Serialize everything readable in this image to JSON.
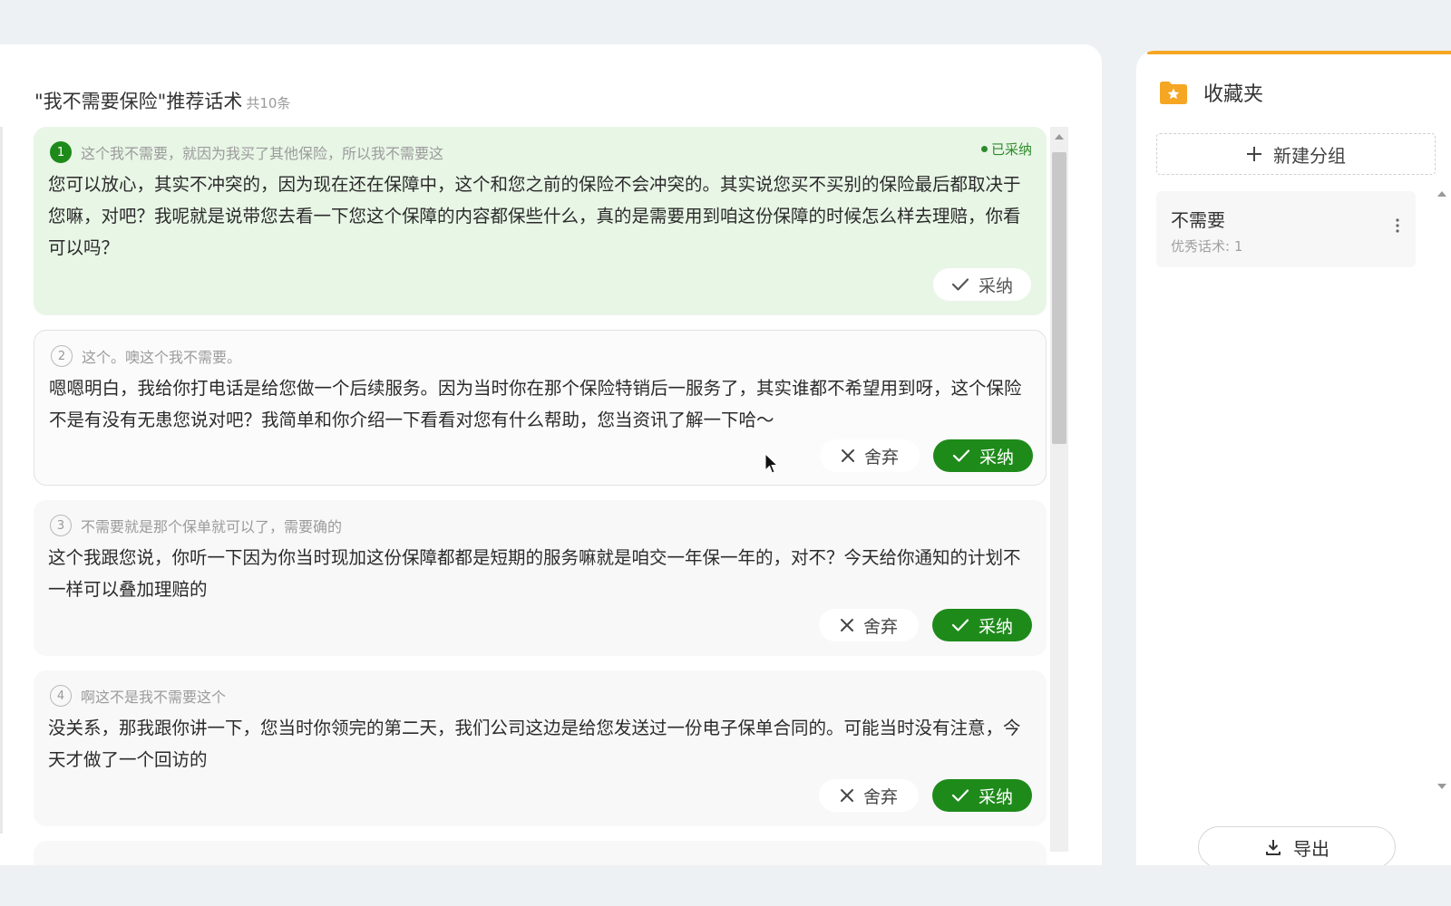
{
  "main": {
    "title": "\"我不需要保险\"推荐话术",
    "count": "共10条",
    "cards": [
      {
        "index": "1",
        "question": "这个我不需要，就因为我买了其他保险，所以我不需要这",
        "answer": "您可以放心，其实不冲突的，因为现在还在保障中，这个和您之前的保险不会冲突的。其实说您买不买别的保险最后都取决于您嘛，对吧？我呢就是说带您去看一下您这个保障的内容都保些什么，真的是需要用到咱这份保障的时候怎么样去理赔，你看可以吗？",
        "status": "已采纳",
        "adopt_label": "采纳"
      },
      {
        "index": "2",
        "question": "这个。噢这个我不需要。",
        "answer": "嗯嗯明白，我给你打电话是给您做一个后续服务。因为当时你在那个保险特销后一服务了，其实谁都不希望用到呀，这个保险不是有没有无患您说对吧？我简单和你介绍一下看看对您有什么帮助，您当资讯了解一下哈～",
        "discard_label": "舍弃",
        "adopt_label": "采纳"
      },
      {
        "index": "3",
        "question": "不需要就是那个保单就可以了，需要确的",
        "answer": "这个我跟您说，你听一下因为你当时现加这份保障都都是短期的服务嘛就是咱交一年保一年的，对不？今天给你通知的计划不一样可以叠加理赔的",
        "discard_label": "舍弃",
        "adopt_label": "采纳"
      },
      {
        "index": "4",
        "question": "啊这不是我不需要这个",
        "answer": "没关系，那我跟你讲一下，您当时你领完的第二天，我们公司这边是给您发送过一份电子保单合同的。可能当时没有注意，今天才做了一个回访的",
        "discard_label": "舍弃",
        "adopt_label": "采纳"
      }
    ]
  },
  "sidebar": {
    "title": "收藏夹",
    "new_group_label": "新建分组",
    "groups": [
      {
        "name": "不需要",
        "count": "优秀话术: 1"
      }
    ],
    "export_label": "导出"
  },
  "colors": {
    "accent_green": "#1e8a1a",
    "adopted_bg": "#e8f6e6",
    "accent_orange": "#f5a623"
  },
  "icons": {
    "folder": "folder-star-icon",
    "plus": "plus-icon",
    "check": "check-icon",
    "close": "close-icon",
    "more": "more-vertical-icon",
    "download": "download-icon"
  }
}
